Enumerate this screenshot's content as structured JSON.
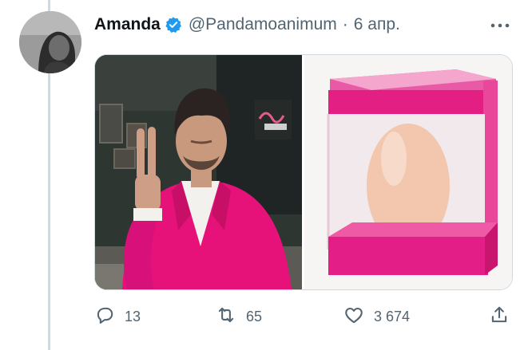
{
  "tweet": {
    "display_name": "Amanda",
    "handle": "@Pandamoanimum",
    "separator": "·",
    "time": "6 апр."
  },
  "actions": {
    "replies": "13",
    "retweets": "65",
    "likes": "3 674"
  },
  "colors": {
    "verified_badge": "#1d9bf0",
    "secondary_text": "#536471",
    "pink": "#e6007e"
  },
  "icons": {
    "verified": "verified-badge-icon",
    "more": "more-horizontal-icon",
    "reply": "reply-icon",
    "retweet": "retweet-icon",
    "like": "heart-icon",
    "share": "share-icon"
  }
}
